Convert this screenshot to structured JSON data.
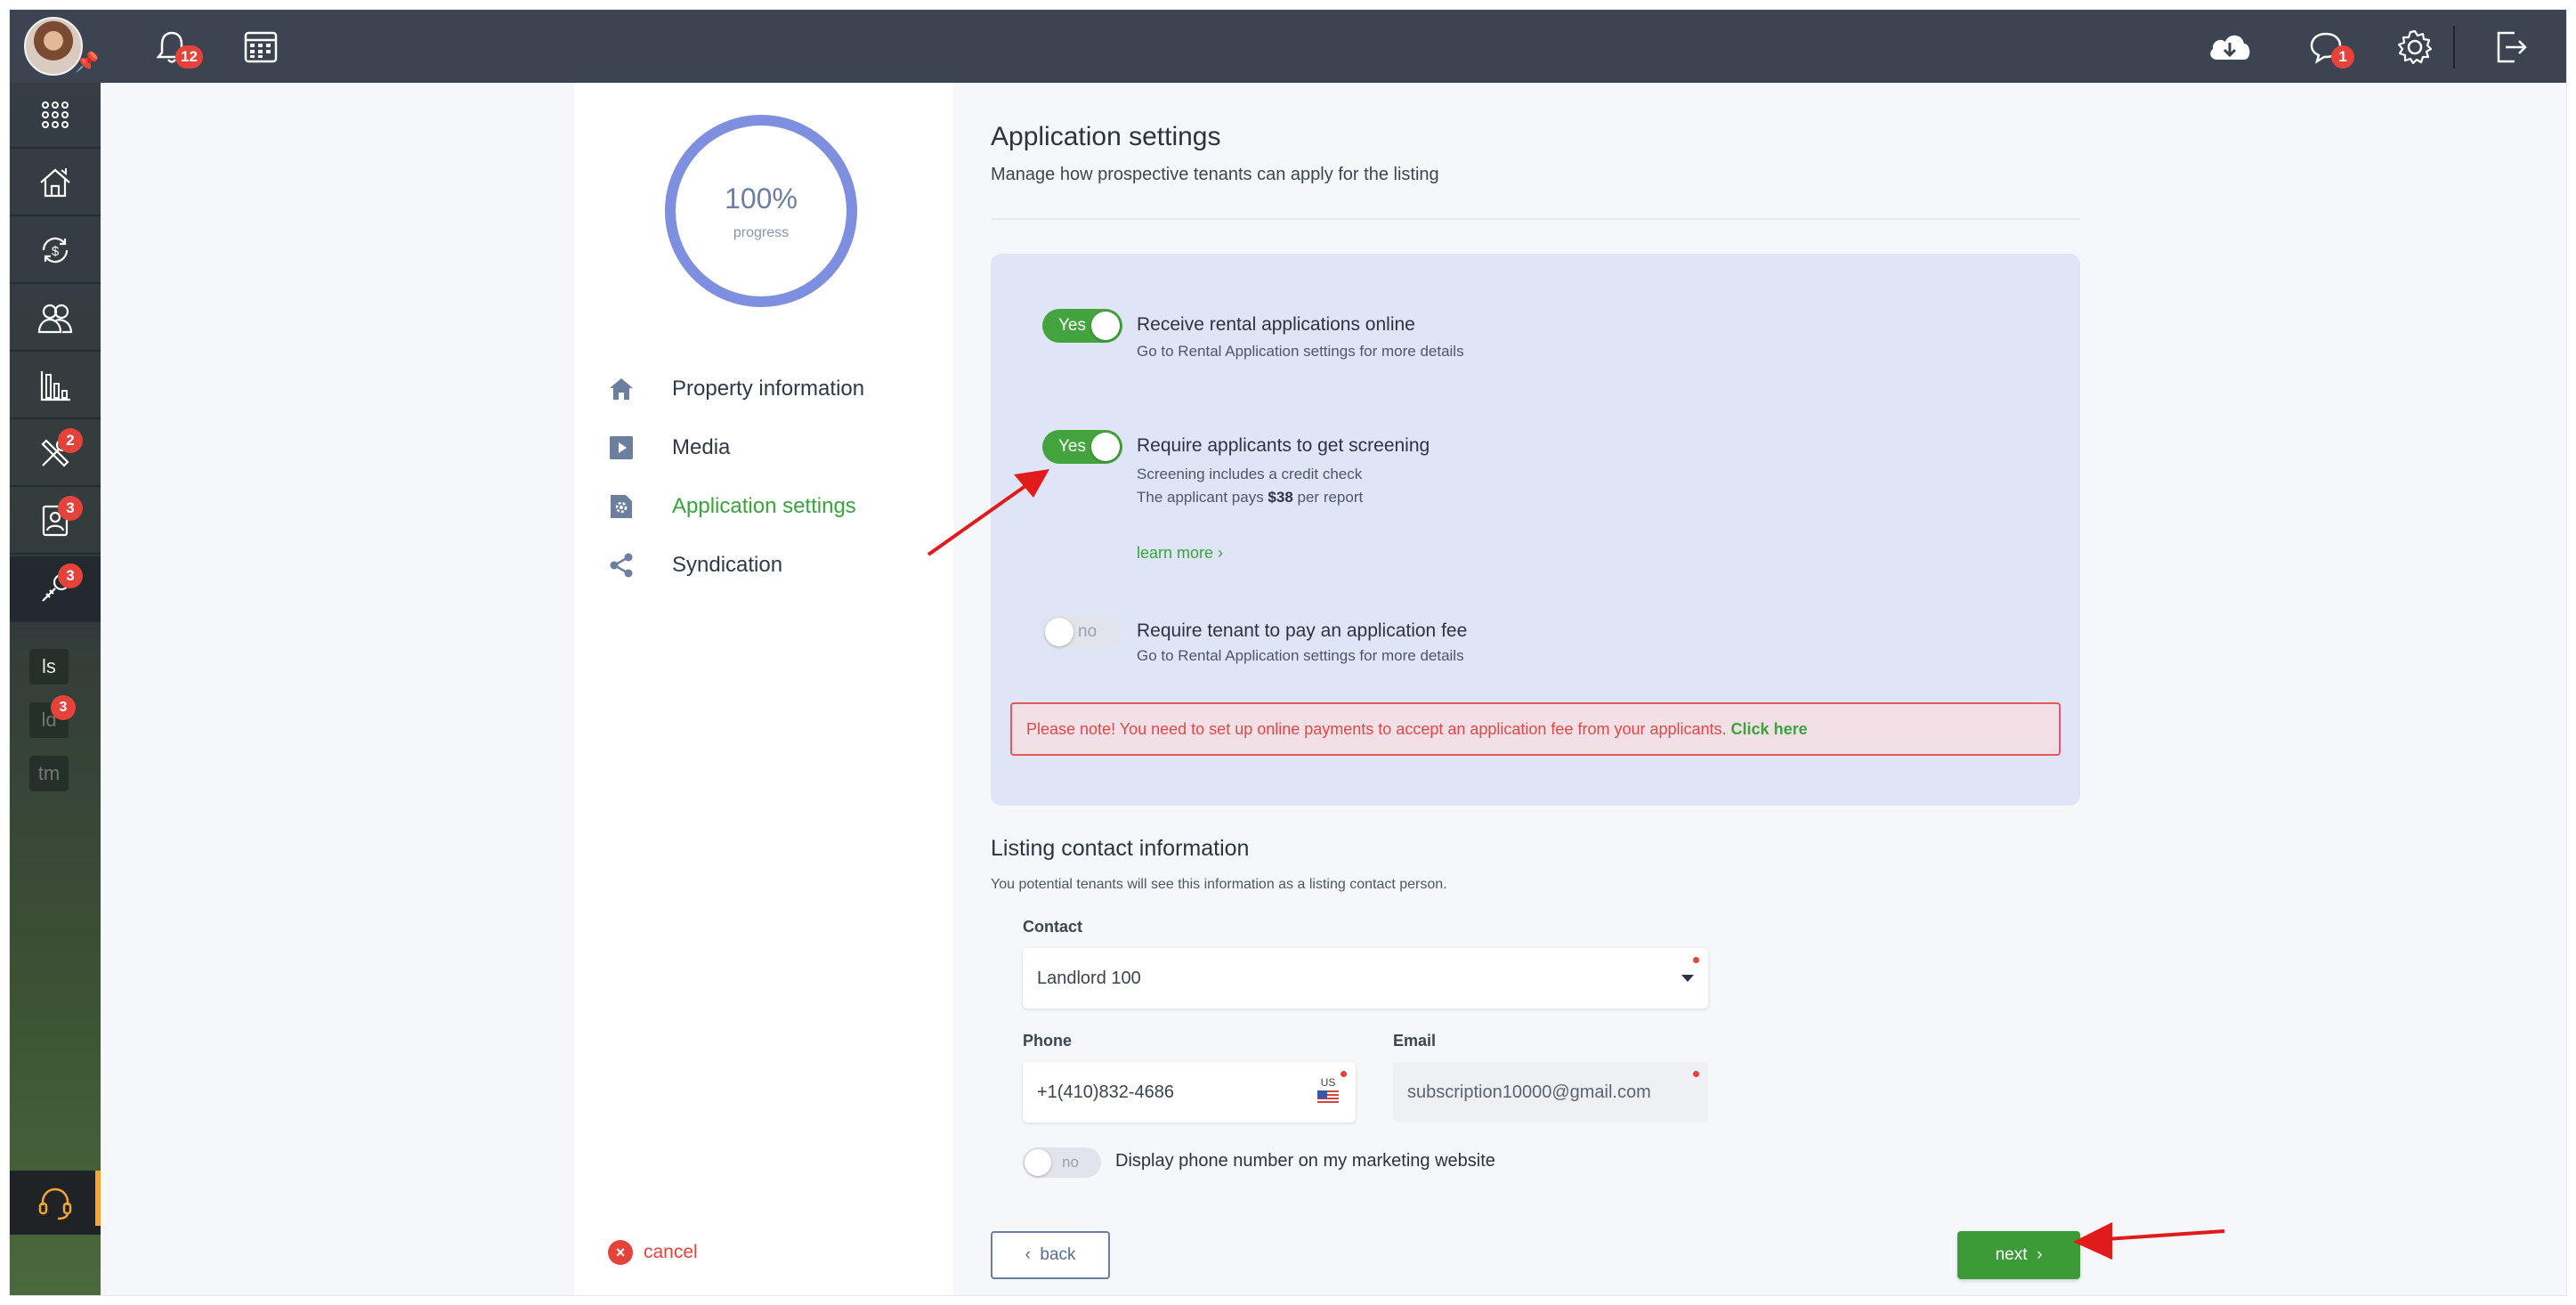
{
  "topbar": {
    "notifications_count": "12",
    "messages_count": "1"
  },
  "sidebar": {
    "items": [
      {
        "name": "apps",
        "badge": ""
      },
      {
        "name": "properties",
        "badge": ""
      },
      {
        "name": "accounting",
        "badge": ""
      },
      {
        "name": "people",
        "badge": ""
      },
      {
        "name": "reports",
        "badge": ""
      },
      {
        "name": "maintenance",
        "badge": "2"
      },
      {
        "name": "applications",
        "badge": "3"
      },
      {
        "name": "tools",
        "badge": "3"
      }
    ],
    "tags": [
      {
        "label": "ls",
        "badge": ""
      },
      {
        "label": "ld",
        "badge": "3"
      },
      {
        "label": "tm",
        "badge": ""
      }
    ]
  },
  "progress": {
    "value": "100%",
    "label": "progress",
    "fraction": 1.0
  },
  "steps": [
    {
      "label": "Property information",
      "icon": "home-icon"
    },
    {
      "label": "Media",
      "icon": "media-icon"
    },
    {
      "label": "Application settings",
      "icon": "settings-file-icon"
    },
    {
      "label": "Syndication",
      "icon": "share-icon"
    }
  ],
  "cancel_label": "cancel",
  "main": {
    "title": "Application settings",
    "subtitle": "Manage how prospective tenants can apply for the listing",
    "settings": [
      {
        "toggle": "Yes",
        "title": "Receive rental applications online",
        "sub1": "Go to Rental Application settings for more details"
      },
      {
        "toggle": "Yes",
        "title": "Require applicants to get screening",
        "sub1": "Screening includes a credit check",
        "sub2_prefix": "The applicant pays ",
        "sub2_amount": "$38",
        "sub2_suffix": " per report",
        "learn_more": "learn more"
      },
      {
        "toggle": "no",
        "title": "Require tenant to pay an application fee",
        "sub1": "Go to Rental Application settings for more details"
      }
    ],
    "note_text": "Please note! You need to set up online payments to accept an application fee from your applicants.",
    "note_link": "Click here",
    "contact_section": {
      "title": "Listing contact information",
      "subtitle": "You potential tenants will see this information as a listing contact person.",
      "contact_label": "Contact",
      "contact_value": "Landlord 100",
      "phone_label": "Phone",
      "phone_value": "+1(410)832-4686",
      "phone_country": "US",
      "email_label": "Email",
      "email_value": "subscription10000@gmail.com",
      "display_toggle": "no",
      "display_label": "Display phone number on my marketing website"
    },
    "back_label": "back",
    "next_label": "next"
  },
  "colors": {
    "accent_green": "#43a33e",
    "badge_red": "#e5423b",
    "progress_ring": "#7f8fe0",
    "panel_blue": "#dfe5f6",
    "arrow_red": "#e11b1b"
  }
}
